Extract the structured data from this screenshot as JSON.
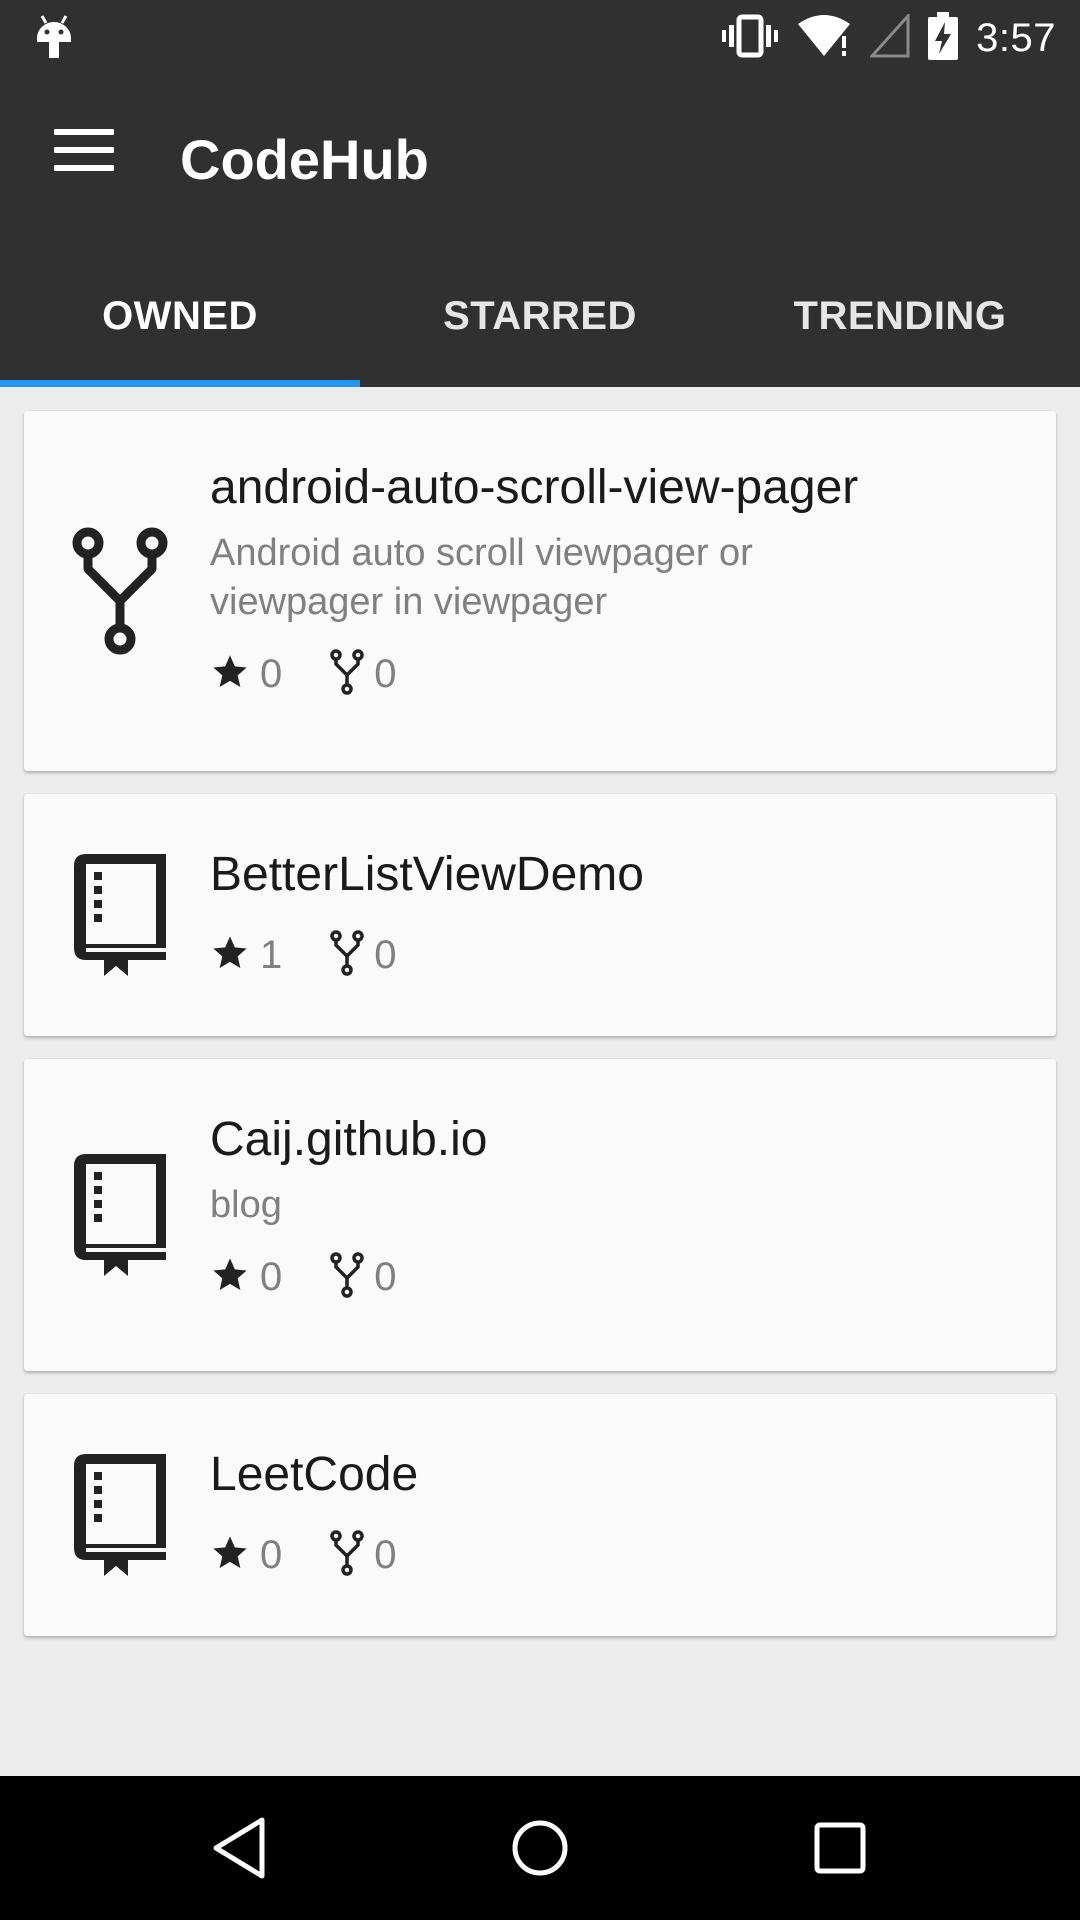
{
  "status_bar": {
    "time": "3:57",
    "icons": [
      "android-icon",
      "vibrate-icon",
      "wifi-icon",
      "signal-icon",
      "battery-charging-icon"
    ]
  },
  "app_bar": {
    "menu_icon": "hamburger-menu-icon",
    "title": "CodeHub"
  },
  "tabs": [
    {
      "label": "OWNED",
      "active": true
    },
    {
      "label": "STARRED",
      "active": false
    },
    {
      "label": "TRENDING",
      "active": false
    }
  ],
  "repos": [
    {
      "name": "android-auto-scroll-view-pager",
      "description_lines": [
        "Android auto scroll viewpager or",
        "viewpager in viewpager"
      ],
      "stars": "0",
      "forks": "0",
      "icon": "fork-icon"
    },
    {
      "name": "BetterListViewDemo",
      "description_lines": [],
      "stars": "1",
      "forks": "0",
      "icon": "repo-book-icon"
    },
    {
      "name": "Caij.github.io",
      "description_lines": [
        "blog"
      ],
      "stars": "0",
      "forks": "0",
      "icon": "repo-book-icon"
    },
    {
      "name": "LeetCode",
      "description_lines": [],
      "stars": "0",
      "forks": "0",
      "icon": "repo-book-icon"
    }
  ],
  "nav_bar": {
    "buttons": [
      "back-icon",
      "home-icon",
      "recents-icon"
    ]
  },
  "colors": {
    "app_bar": "#303030",
    "tab_indicator": "#2196f3",
    "background": "#ececec",
    "card": "#fafafa"
  }
}
